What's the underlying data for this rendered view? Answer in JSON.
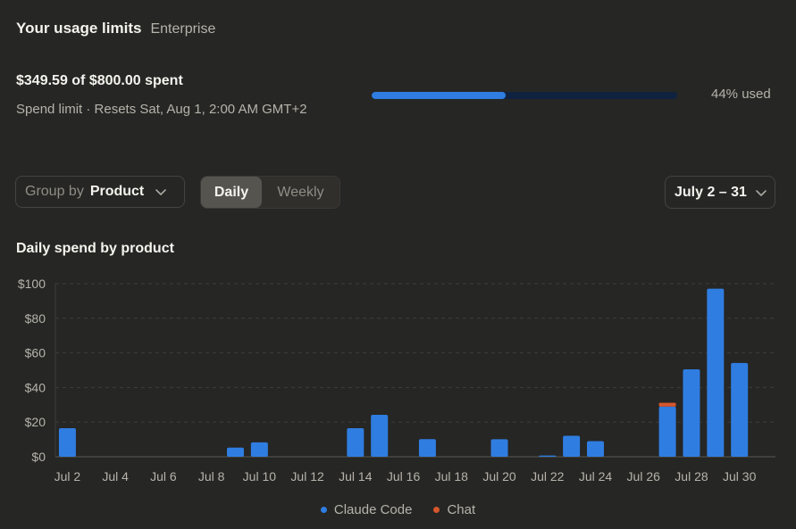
{
  "header": {
    "title": "Your usage limits",
    "plan": "Enterprise"
  },
  "usage": {
    "spent_text": "$349.59 of $800.00 spent",
    "limit_text": "Spend limit · Resets Sat, Aug 1, 2:00 AM GMT+2",
    "progress_fraction": 0.44,
    "used_text": "44% used"
  },
  "controls": {
    "group_by_label": "Group by",
    "group_by_value": "Product",
    "toggle_daily": "Daily",
    "toggle_weekly": "Weekly",
    "date_range": "July 2 – 31"
  },
  "colors": {
    "claude_code": "#2f7de1",
    "chat": "#d5562d",
    "progress_track": "#0f2340"
  },
  "chart_data": {
    "type": "bar",
    "stacked": true,
    "title": "Daily spend by product",
    "categories": [
      "Jul 2",
      "Jul 3",
      "Jul 4",
      "Jul 5",
      "Jul 6",
      "Jul 7",
      "Jul 8",
      "Jul 9",
      "Jul 10",
      "Jul 11",
      "Jul 12",
      "Jul 13",
      "Jul 14",
      "Jul 15",
      "Jul 16",
      "Jul 17",
      "Jul 18",
      "Jul 19",
      "Jul 20",
      "Jul 21",
      "Jul 22",
      "Jul 23",
      "Jul 24",
      "Jul 25",
      "Jul 26",
      "Jul 27",
      "Jul 28",
      "Jul 29",
      "Jul 30",
      "Jul 31"
    ],
    "x_tick_labels": [
      "Jul 2",
      "Jul 4",
      "Jul 6",
      "Jul 8",
      "Jul 10",
      "Jul 12",
      "Jul 14",
      "Jul 16",
      "Jul 18",
      "Jul 20",
      "Jul 22",
      "Jul 24",
      "Jul 26",
      "Jul 28",
      "Jul 30"
    ],
    "y_ticks": [
      0,
      20,
      40,
      60,
      80,
      100
    ],
    "y_tick_labels": [
      "$0",
      "$20",
      "$40",
      "$60",
      "$80",
      "$100"
    ],
    "ylim": [
      0,
      100
    ],
    "grid": true,
    "legend_position": "bottom-center",
    "series": [
      {
        "name": "Claude Code",
        "values": [
          16.5,
          0,
          0,
          0,
          0,
          0,
          0,
          5.3,
          8.3,
          0,
          0,
          0,
          16.5,
          24.2,
          0,
          10.2,
          0,
          0,
          10.1,
          0,
          0.7,
          12.1,
          9,
          0,
          0,
          29,
          50.5,
          97.1,
          54.2,
          0
        ]
      },
      {
        "name": "Chat",
        "values": [
          0,
          0,
          0,
          0,
          0,
          0,
          0,
          0,
          0,
          0,
          0,
          0,
          0,
          0,
          0,
          0,
          0,
          0,
          0,
          0,
          0,
          0,
          0,
          0,
          0,
          2.2,
          0,
          0,
          0,
          0
        ]
      }
    ]
  }
}
